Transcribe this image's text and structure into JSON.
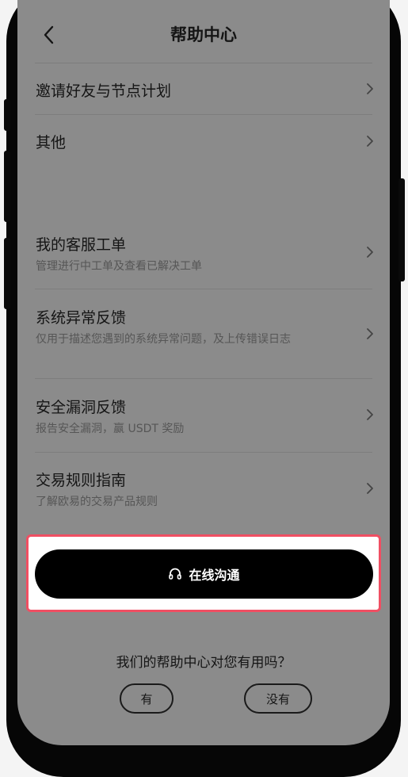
{
  "header": {
    "title": "帮助中心",
    "back_icon": "chevron-left-icon"
  },
  "topics": [
    {
      "label": "邀请好友与节点计划"
    },
    {
      "label": "其他"
    }
  ],
  "services": [
    {
      "title": "我的客服工单",
      "desc": "管理进行中工单及查看已解决工单"
    },
    {
      "title": "系统异常反馈",
      "desc": "仅用于描述您遇到的系统异常问题，及上传错误日志"
    },
    {
      "title": "安全漏洞反馈",
      "desc": "报告安全漏洞，赢 USDT 奖励"
    },
    {
      "title": "交易规则指南",
      "desc": "了解欧易的交易产品规则"
    }
  ],
  "chat_button": {
    "label": "在线沟通",
    "icon": "headset-icon"
  },
  "feedback": {
    "question": "我们的帮助中心对您有用吗？",
    "yes": "有",
    "no": "没有"
  },
  "colors": {
    "highlight_border": "#f04f63",
    "screen_overlay": "#8b8b8b",
    "button": "#000000"
  }
}
